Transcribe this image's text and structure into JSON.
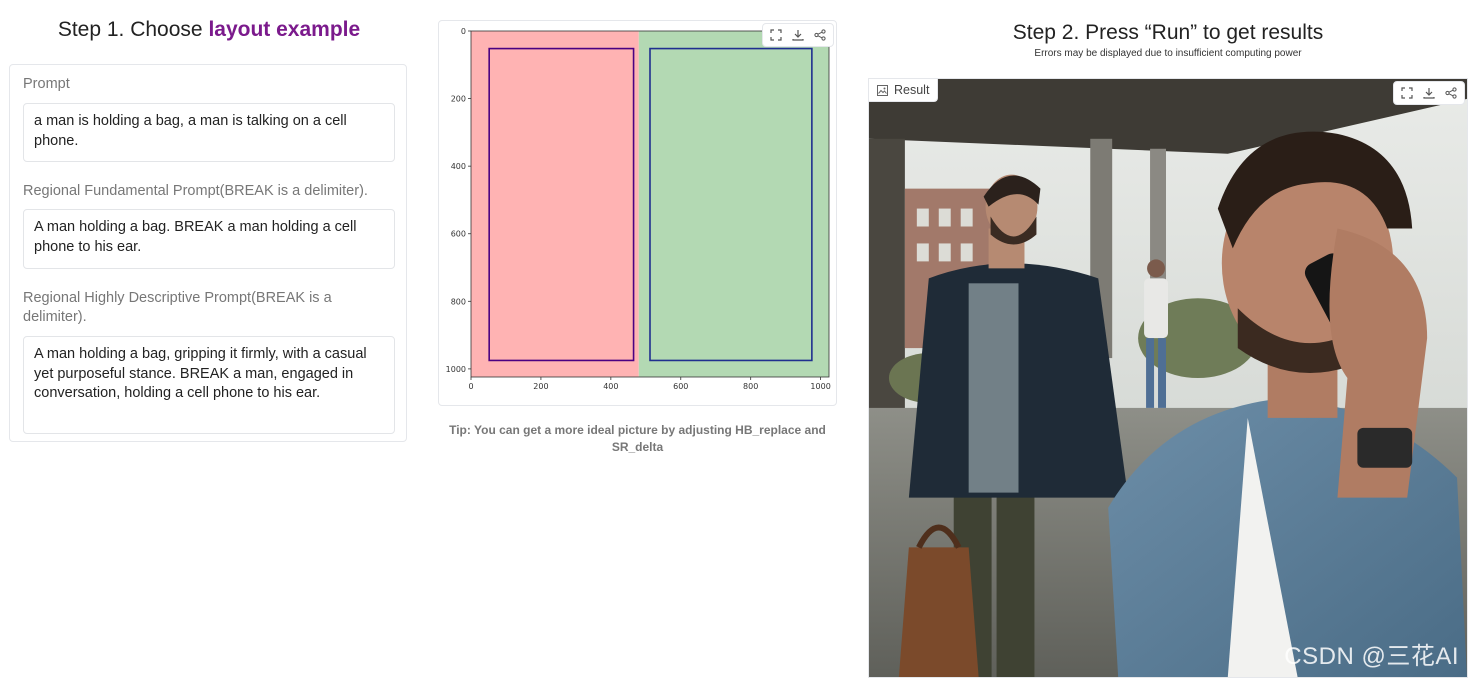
{
  "step1": {
    "title_prefix": "Step 1. Choose ",
    "title_accent": "layout example"
  },
  "prompt_panel": {
    "prompt_label": "Prompt",
    "prompt_value": "a man is holding a bag, a man is talking on a cell phone.",
    "regional_fundamental_label": "Regional Fundamental Prompt(BREAK is a delimiter).",
    "regional_fundamental_value": "A man holding a bag. BREAK a man holding a cell phone to his ear.",
    "regional_descriptive_label": "Regional Highly Descriptive Prompt(BREAK is a delimiter).",
    "regional_descriptive_value": "A man holding a bag, gripping it firmly, with a casual yet purposeful stance. BREAK a man, engaged in conversation, holding a cell phone to his ear."
  },
  "layout_plot": {
    "tip": "Tip: You can get a more ideal picture by adjusting HB_replace and SR_delta",
    "toolbar": [
      "fullscreen-icon",
      "download-icon",
      "share-icon"
    ]
  },
  "chart_data": {
    "type": "heatmap",
    "x_ticks": [
      0,
      200,
      400,
      600,
      800,
      1000
    ],
    "y_ticks": [
      0,
      200,
      400,
      600,
      800,
      1000
    ],
    "xlim": [
      0,
      1024
    ],
    "ylim": [
      1024,
      0
    ],
    "regions": [
      {
        "x": [
          0,
          480
        ],
        "y": [
          0,
          1024
        ],
        "color": "#ffb3b3"
      },
      {
        "x": [
          480,
          1024
        ],
        "y": [
          0,
          1024
        ],
        "color": "#b3d9b3"
      }
    ],
    "boxes": [
      {
        "x": [
          52,
          465
        ],
        "y": [
          52,
          975
        ],
        "color": "#4b0082"
      },
      {
        "x": [
          512,
          975
        ],
        "y": [
          52,
          975
        ],
        "color": "#1f2f8f"
      }
    ]
  },
  "step2": {
    "title": "Step 2. Press “Run” to get results",
    "note": "Errors may be displayed due to insufficient computing power"
  },
  "result": {
    "label": "Result",
    "toolbar": [
      "fullscreen-icon",
      "download-icon",
      "share-icon"
    ],
    "watermark": "CSDN @三花AI"
  },
  "colors": {
    "accent": "#7b1a8c"
  }
}
